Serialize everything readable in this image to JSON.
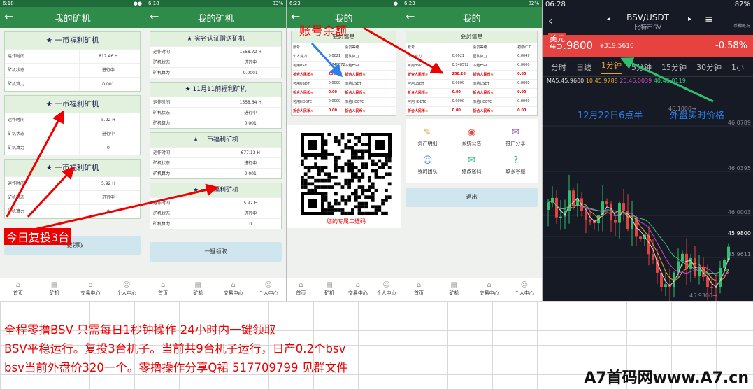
{
  "phone1": {
    "status": "6:18",
    "title": "我的矿机",
    "cards": [
      {
        "title": "★ 一币福利矿机",
        "rows": [
          [
            "运作时间",
            "817.46 H"
          ],
          [
            "矿机状态",
            "进行中"
          ],
          [
            "矿机算力",
            "0.001"
          ]
        ]
      },
      {
        "title": "★ 一币福利矿机",
        "rows": [
          [
            "运作时间",
            "5.92 H"
          ],
          [
            "矿机状态",
            "进行中"
          ],
          [
            "矿机算力",
            "0"
          ]
        ]
      },
      {
        "title": "★ 一币福利矿机",
        "rows": [
          [
            "运作时间",
            "5.92 H"
          ],
          [
            "矿机状态",
            "进行中"
          ],
          [
            "矿机算力",
            "0"
          ]
        ]
      }
    ],
    "button": "一键领取",
    "tabs": [
      "首页",
      "矿机",
      "交易中心",
      "个人中心"
    ]
  },
  "phone2": {
    "status": "6:18",
    "battery": "83%",
    "title": "我的矿机",
    "cards": [
      {
        "title": "★ 实名认证赠送矿机",
        "rows": [
          [
            "运作时间",
            "1558.72 H"
          ],
          [
            "矿机状态",
            "进行中"
          ],
          [
            "矿机算力",
            "0.0001"
          ]
        ]
      },
      {
        "title": "★ 11月11前福利矿机",
        "rows": [
          [
            "运作时间",
            "1558.64 H"
          ],
          [
            "矿机状态",
            "进行中"
          ],
          [
            "矿机算力",
            "0.001"
          ]
        ]
      },
      {
        "title": "★ 一币福利矿机",
        "rows": [
          [
            "运作时间",
            "677.13 H"
          ],
          [
            "矿机状态",
            "进行中"
          ],
          [
            "矿机算力",
            "0.001"
          ]
        ]
      },
      {
        "title": "★ 一币福利矿机",
        "rows": [
          [
            "运作时间",
            "5.92 H"
          ],
          [
            "矿机状态",
            "进行中"
          ],
          [
            "矿机算力",
            "0"
          ]
        ]
      }
    ],
    "button": "一键领取",
    "tabs": [
      "首页",
      "矿机",
      "交易中心",
      "个人中心"
    ]
  },
  "phone3": {
    "status": "6:23",
    "title": "我的",
    "info_title": "会员信息",
    "grid": [
      [
        "账号",
        "",
        "会员等级",
        ""
      ],
      [
        "个人算力",
        "0.0021",
        "团队算力",
        ""
      ],
      [
        "可用BSV",
        "0.748572",
        "冻结BSV",
        ""
      ],
      [
        "折合人民币≈",
        "258.26",
        "折合人民币≈",
        ""
      ],
      [
        "可用USDT",
        "0.0000",
        "冻结USDT",
        ""
      ],
      [
        "折合人民币≈",
        "0.00",
        "折合人民币≈",
        ""
      ],
      [
        "可用HDBTC",
        "0.0000",
        "冻结HDBTC",
        ""
      ],
      [
        "折合人民币≈",
        "0.00",
        "折合人民币≈",
        ""
      ]
    ],
    "qr_caption": "您的专属二维码",
    "tabs": [
      "首页",
      "矿机",
      "交易中心",
      "个人中心"
    ]
  },
  "phone4": {
    "status": "6:23",
    "battery": "82%",
    "title": "我的",
    "info_title": "会员信息",
    "grid": [
      [
        "账号",
        "",
        "会员等级",
        "初级矿工"
      ],
      [
        "个人算力",
        "0.0021",
        "团队算力",
        "0.0049"
      ],
      [
        "可用BSV",
        "0.748572",
        "冻结BSV",
        "0.0000"
      ],
      [
        "折合人民币≈",
        "258.26",
        "折合人民币≈",
        "0.00"
      ],
      [
        "可用USDT",
        "0.0000",
        "冻结USDT",
        "0.0000"
      ],
      [
        "折合人民币≈",
        "0.00",
        "折合人民币≈",
        "0.00"
      ],
      [
        "可用HDBTC",
        "0.0000",
        "冻结HDBTC",
        "0.0000"
      ],
      [
        "折合人民币≈",
        "0.00",
        "折合人民币≈",
        "0.00"
      ]
    ],
    "menu": [
      "资产明细",
      "系统公告",
      "推广分享",
      "我的团队",
      "修改密码",
      "联系客服"
    ],
    "logout": "退出",
    "tabs": [
      "首页",
      "矿机",
      "交易中心",
      "个人中心"
    ]
  },
  "bsv": {
    "time": "06:28",
    "battery": "82%",
    "pair": "BSV/USDT",
    "name": "比特币SV",
    "currency": "币种概况",
    "price": "45.9800",
    "cny": "¥319.5610",
    "change": "-0.58%",
    "timeframes": [
      "分时",
      "日线",
      "1分钟",
      "5分钟",
      "15分钟",
      "30分钟",
      "1小"
    ],
    "active_tf": "1分钟",
    "ma": "MA5:45.9600",
    "ma10": "10:45.9788",
    "ma20": "20:46.0039",
    "ma40": "40:46.0119",
    "yaxis": [
      "46.0789",
      "46.0395",
      "46.0003",
      "45.9800",
      "45.9611"
    ],
    "hi_label": "46.1000→",
    "lo_label": "45.9300→"
  },
  "annotations": {
    "balance": "账号余额",
    "usd": "美元",
    "time_note": "12月22日6点半",
    "live_price": "外盘实时价格",
    "reinvest": "今日复投3台"
  },
  "notes": [
    "全程零撸BSV 只需每日1秒钟操作 24小时内一键领取",
    "BSV平稳运行。复投3台机子。当前共9台机子运行，日产0.2个bsv",
    "bsv当前外盘价320一个。零撸操作分享Q裙 517709799 见群文件"
  ],
  "watermark": "A7首码网www.A7.cn",
  "colors": {
    "green": "#2e8b4a",
    "red": "#e00000",
    "up": "#e64340",
    "down": "#2fbf71"
  }
}
